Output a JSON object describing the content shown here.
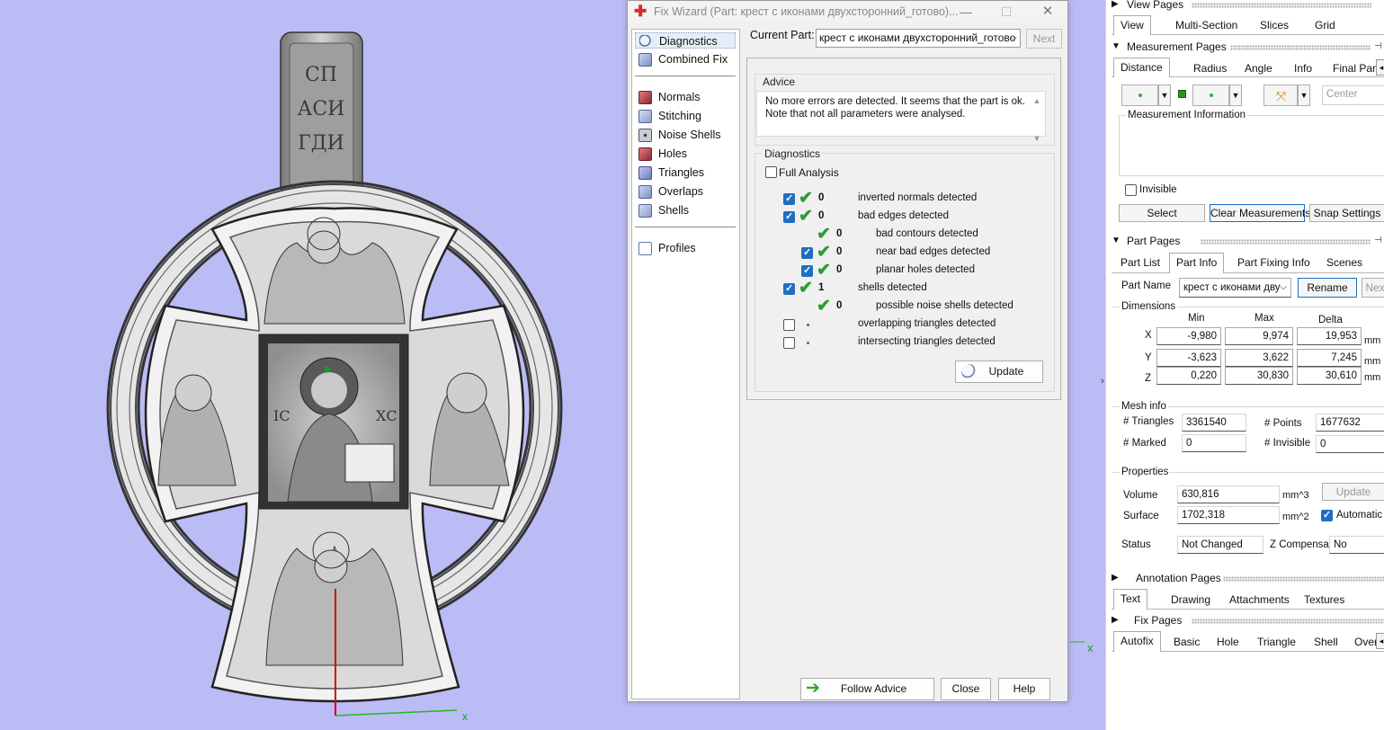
{
  "viewport": {
    "model_text": {
      "top": [
        "СП",
        "АСИ",
        "ГДИ"
      ],
      "left_ic": "ІС",
      "right_ic": "ХС"
    },
    "axis": {
      "x_label": "x"
    }
  },
  "dialog": {
    "title": "Fix Wizard (Part: крест с иконами двухсторонний_готово)...",
    "window_controls": {
      "minimize": "—",
      "maximize": "☐",
      "close": "✕"
    },
    "nav": {
      "diagnostics": "Diagnostics",
      "combined_fix": "Combined Fix",
      "normals": "Normals",
      "stitching": "Stitching",
      "noise_shells": "Noise Shells",
      "holes": "Holes",
      "triangles": "Triangles",
      "overlaps": "Overlaps",
      "shells": "Shells",
      "profiles": "Profiles"
    },
    "current_part_label": "Current Part:",
    "current_part_value": "крест с иконами двухсторонний_готово",
    "next_label": "Next",
    "advice": {
      "title": "Advice",
      "line1": "No more errors are detected. It seems that the part is ok.",
      "line2": "Note that not all parameters were analysed."
    },
    "diagnostics": {
      "title": "Diagnostics",
      "full_analysis_label": "Full Analysis",
      "rows": [
        {
          "count": "0",
          "label": "inverted normals detected"
        },
        {
          "count": "0",
          "label": "bad edges detected"
        },
        {
          "count": "0",
          "label": "bad contours detected"
        },
        {
          "count": "0",
          "label": "near bad edges detected"
        },
        {
          "count": "0",
          "label": "planar holes detected"
        },
        {
          "count": "1",
          "label": "shells detected"
        },
        {
          "count": "0",
          "label": "possible noise shells detected"
        },
        {
          "count": "",
          "label": "overlapping triangles detected"
        },
        {
          "count": "",
          "label": "intersecting triangles detected"
        }
      ],
      "update_label": "Update"
    },
    "buttons": {
      "follow_advice": "Follow Advice",
      "close": "Close",
      "help": "Help"
    }
  },
  "panel": {
    "view_pages": {
      "title": "View Pages",
      "tabs": [
        "View",
        "Multi-Section",
        "Slices",
        "Grid"
      ]
    },
    "measurement_pages": {
      "title": "Measurement Pages",
      "tabs": [
        "Distance",
        "Radius",
        "Angle",
        "Info",
        "Final Part"
      ],
      "center_placeholder": "Center",
      "info_title": "Measurement Information",
      "invisible_label": "Invisible",
      "select_label": "Select",
      "clear_label": "Clear Measurements",
      "snap_label": "Snap Settings"
    },
    "part_pages": {
      "title": "Part Pages",
      "tabs": [
        "Part List",
        "Part Info",
        "Part Fixing Info",
        "Scenes"
      ],
      "part_name_label": "Part Name",
      "part_name_value": "крест с иконами дву",
      "rename_label": "Rename",
      "next_label": "Nex",
      "dimensions": {
        "title": "Dimensions",
        "headers": [
          "Min",
          "Max",
          "Delta"
        ],
        "rows": [
          {
            "axis": "X",
            "min": "-9,980",
            "max": "9,974",
            "delta": "19,953",
            "unit": "mm"
          },
          {
            "axis": "Y",
            "min": "-3,623",
            "max": "3,622",
            "delta": "7,245",
            "unit": "mm"
          },
          {
            "axis": "Z",
            "min": "0,220",
            "max": "30,830",
            "delta": "30,610",
            "unit": "mm"
          }
        ]
      },
      "mesh_info": {
        "title": "Mesh info",
        "triangles_label": "# Triangles",
        "triangles_value": "3361540",
        "points_label": "# Points",
        "points_value": "1677632",
        "marked_label": "# Marked",
        "marked_value": "0",
        "invisible_label": "# Invisible",
        "invisible_value": "0"
      },
      "properties": {
        "title": "Properties",
        "volume_label": "Volume",
        "volume_value": "630,816",
        "volume_unit": "mm^3",
        "surface_label": "Surface",
        "surface_value": "1702,318",
        "surface_unit": "mm^2",
        "update_label": "Update",
        "automatic_label": "Automatic"
      },
      "status_label": "Status",
      "status_value": "Not Changed",
      "zcomp_label": "Z Compensated",
      "zcomp_value": "No"
    },
    "annotation_pages": {
      "title": "Annotation Pages",
      "tabs": [
        "Text",
        "Drawing",
        "Attachments",
        "Textures"
      ]
    },
    "fix_pages": {
      "title": "Fix Pages",
      "tabs": [
        "Autofix",
        "Basic",
        "Hole",
        "Triangle",
        "Shell",
        "Over"
      ]
    },
    "colors": {
      "accent": "#1f6ec2",
      "check_green": "#2d9b35",
      "viewport_bg": "#bbbbf5"
    }
  }
}
